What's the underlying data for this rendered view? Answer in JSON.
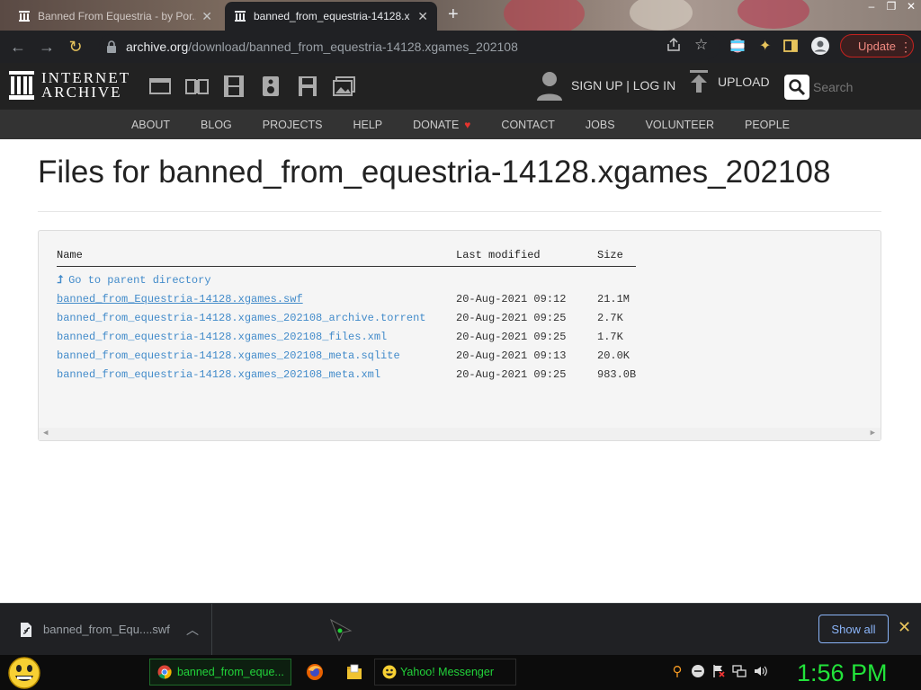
{
  "browser": {
    "tabs": [
      {
        "title": "Banned From Equestria - by Por...",
        "active": false
      },
      {
        "title": "banned_from_equestria-14128.x",
        "active": true
      }
    ],
    "url_host": "archive.org",
    "url_path": "/download/banned_from_equestria-14128.xgames_202108",
    "update_label": "Update"
  },
  "ia": {
    "logo_line1": "INTERNET",
    "logo_line2": "ARCHIVE",
    "signup_label": "SIGN UP | LOG IN",
    "upload_label": "UPLOAD",
    "search_placeholder": "Search",
    "nav": [
      "ABOUT",
      "BLOG",
      "PROJECTS",
      "HELP",
      "DONATE",
      "CONTACT",
      "JOBS",
      "VOLUNTEER",
      "PEOPLE"
    ]
  },
  "page": {
    "title": "Files for banned_from_equestria-14128.xgames_202108",
    "columns": {
      "name": "Name",
      "modified": "Last modified",
      "size": "Size"
    },
    "parent_label": "Go to parent directory",
    "files": [
      {
        "name": "banned_from_Equestria-14128.xgames.swf",
        "modified": "20-Aug-2021 09:12",
        "size": "21.1M"
      },
      {
        "name": "banned_from_equestria-14128.xgames_202108_archive.torrent",
        "modified": "20-Aug-2021 09:25",
        "size": "2.7K"
      },
      {
        "name": "banned_from_equestria-14128.xgames_202108_files.xml",
        "modified": "20-Aug-2021 09:25",
        "size": "1.7K"
      },
      {
        "name": "banned_from_equestria-14128.xgames_202108_meta.sqlite",
        "modified": "20-Aug-2021 09:13",
        "size": "20.0K"
      },
      {
        "name": "banned_from_equestria-14128.xgames_202108_meta.xml",
        "modified": "20-Aug-2021 09:25",
        "size": "983.0B"
      }
    ]
  },
  "downloads": {
    "item_name": "banned_from_Equ....swf",
    "show_all_label": "Show all"
  },
  "taskbar": {
    "chrome_task": "banned_from_eque...",
    "yahoo_task": "Yahoo! Messenger",
    "clock": "1:56 PM"
  },
  "colors": {
    "link": "#428bca",
    "ia_header": "#222222",
    "taskbar_text": "#22d33a"
  }
}
